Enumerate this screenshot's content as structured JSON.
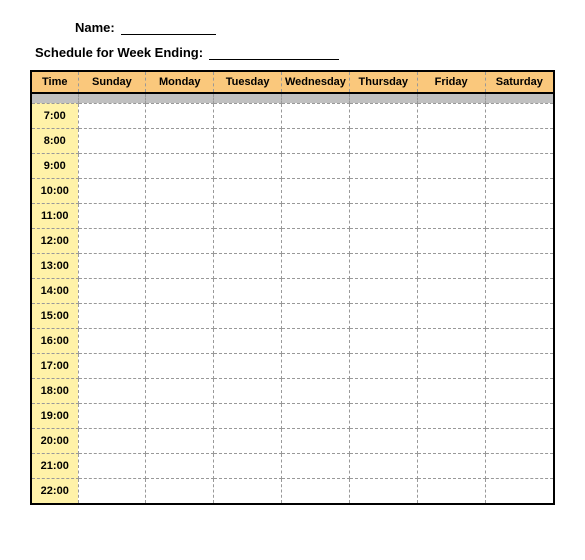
{
  "form": {
    "name_label": "Name:",
    "name_value": "",
    "week_label": "Schedule for Week Ending:",
    "week_value": ""
  },
  "headers": {
    "time": "Time",
    "days": [
      "Sunday",
      "Monday",
      "Tuesday",
      "Wednesday",
      "Thursday",
      "Friday",
      "Saturday"
    ]
  },
  "times": [
    "7:00",
    "8:00",
    "9:00",
    "10:00",
    "11:00",
    "12:00",
    "13:00",
    "14:00",
    "15:00",
    "16:00",
    "17:00",
    "18:00",
    "19:00",
    "20:00",
    "21:00",
    "22:00"
  ],
  "cells": {}
}
